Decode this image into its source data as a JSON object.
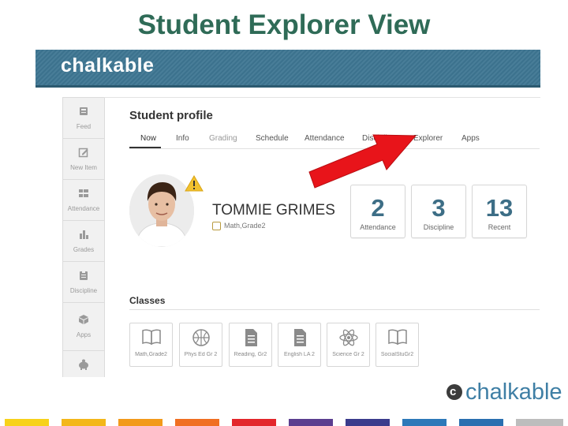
{
  "slide": {
    "title": "Student Explorer View"
  },
  "header": {
    "logo": "chalkable"
  },
  "sidebar": {
    "items": [
      {
        "label": "Feed",
        "icon": "feed-icon"
      },
      {
        "label": "New Item",
        "icon": "edit-icon"
      },
      {
        "label": "Attendance",
        "icon": "attendance-icon"
      },
      {
        "label": "Grades",
        "icon": "grades-icon"
      },
      {
        "label": "Discipline",
        "icon": "discipline-icon"
      },
      {
        "label": "Apps",
        "icon": "apps-icon"
      },
      {
        "label": "",
        "icon": "piggy-bank-icon"
      }
    ]
  },
  "profile": {
    "title": "Student profile",
    "tabs": [
      "Now",
      "Info",
      "Grading",
      "Schedule",
      "Attendance",
      "Discipline",
      "Explorer",
      "Apps"
    ],
    "active_tab": "Now",
    "student_name": "TOMMIE GRIMES",
    "class_label": "Math,Grade2",
    "stats": [
      {
        "value": "2",
        "label": "Attendance"
      },
      {
        "value": "3",
        "label": "Discipline"
      },
      {
        "value": "13",
        "label": "Recent"
      }
    ]
  },
  "classes": {
    "title": "Classes",
    "items": [
      {
        "label": "Math,Grade2",
        "icon": "book-icon"
      },
      {
        "label": "Phys Ed Gr 2",
        "icon": "basketball-icon"
      },
      {
        "label": "Reading, Gr2",
        "icon": "document-icon"
      },
      {
        "label": "English LA 2",
        "icon": "document-icon"
      },
      {
        "label": "Science Gr 2",
        "icon": "atom-icon"
      },
      {
        "label": "SocialStuGr2",
        "icon": "book-icon"
      }
    ]
  },
  "footer": {
    "logo_text": "chalkable",
    "logo_mark": "c"
  },
  "colors": {
    "title": "#2f6b57",
    "header": "#3e7692",
    "accent_number": "#3d6e86",
    "arrow": "#e8141a",
    "stripes": [
      "#f7d21b",
      "#f3b71a",
      "#f29a1b",
      "#f06f22",
      "#e3262b",
      "#5b3e8f",
      "#3a3b8c",
      "#2d79b9",
      "#2a6fb0",
      "#bdbdbd"
    ]
  }
}
